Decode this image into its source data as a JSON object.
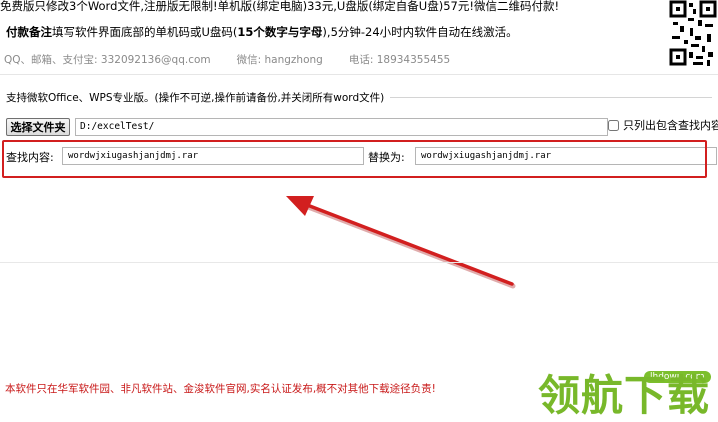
{
  "notice": {
    "line1": "免费版只修改3个Word文件,注册版无限制!单机版(绑定电脑)33元,U盘版(绑定自备U盘)57元!微信二维码付款!",
    "line2_bold": "付款备注",
    "line2_a": "填写软件界面底部的单机码或U盘码(",
    "line2_bold2": "15个数字与字母",
    "line2_b": "),5分钟-24小时内软件自动在线激活。",
    "contact_qq": "QQ、邮箱、支付宝: 332092136@qq.com",
    "contact_wechat": "微信: hangzhong",
    "contact_phone": "电话: 18934355455"
  },
  "options": {
    "legend": "支持微软Office、WPS专业版。(操作不可逆,操作前请备份,并关闭所有word文件)"
  },
  "folder": {
    "button_label": "选择文件夹",
    "path_value": "D:/excelTest/",
    "only_list_label": "只列出包含查找内容"
  },
  "find": {
    "label": "查找内容:",
    "value": "wordwjxiugashjanjdmj.rar"
  },
  "replace": {
    "label": "替换为:",
    "value": "wordwjxiugashjanjdmj.rar"
  },
  "footer": {
    "note": "本软件只在华军软件园、非凡软件站、金浚软件官网,实名认证发布,概不对其他下载途径负责!"
  },
  "watermark": {
    "url": "lhdown.com",
    "logo_text": "领航下载"
  },
  "colors": {
    "highlight": "#d21f1f",
    "footer_text": "#c81818",
    "watermark_green": "#78b82a"
  }
}
